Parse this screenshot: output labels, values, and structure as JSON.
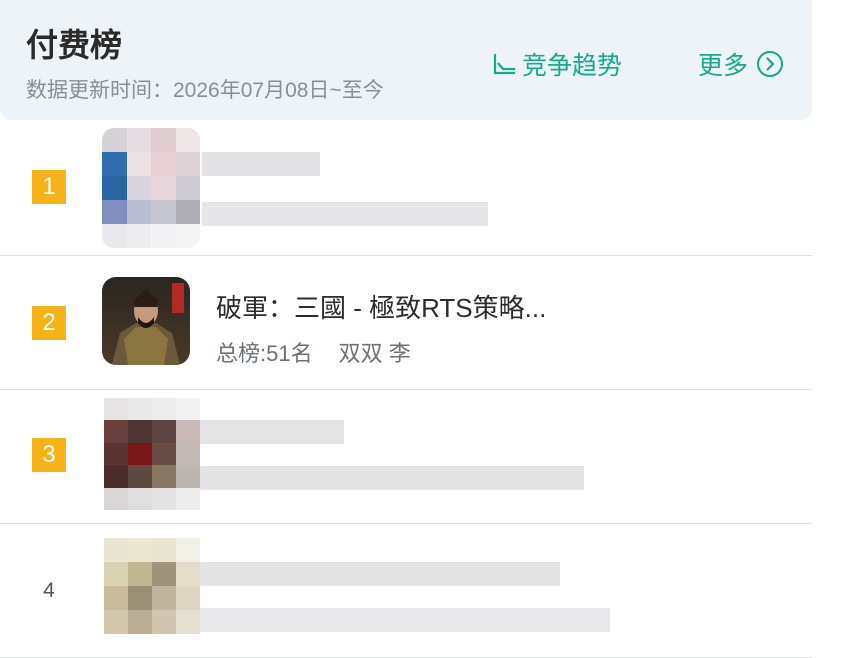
{
  "header": {
    "title": "付费榜",
    "subtitle": "数据更新时间：2026年07月08日~至今",
    "trend_label": "竞争趋势",
    "more_label": "更多"
  },
  "rows": [
    {
      "rank": "1",
      "name": "",
      "rank_text": "",
      "developer": ""
    },
    {
      "rank": "2",
      "name": "破軍：三國 - 極致RTS策略...",
      "rank_text": "总榜:51名",
      "developer": "双双 李"
    },
    {
      "rank": "3",
      "name": "",
      "rank_text": "",
      "developer": ""
    },
    {
      "rank": "4",
      "name": "",
      "rank_text": "",
      "developer": ""
    }
  ],
  "colors": {
    "accent": "#16a98a",
    "rank_badge": "#f7b217",
    "header_bg": "#eef3f8"
  },
  "icons": {
    "trend": "line-chart-icon",
    "more": "chevron-right-circle-icon"
  }
}
